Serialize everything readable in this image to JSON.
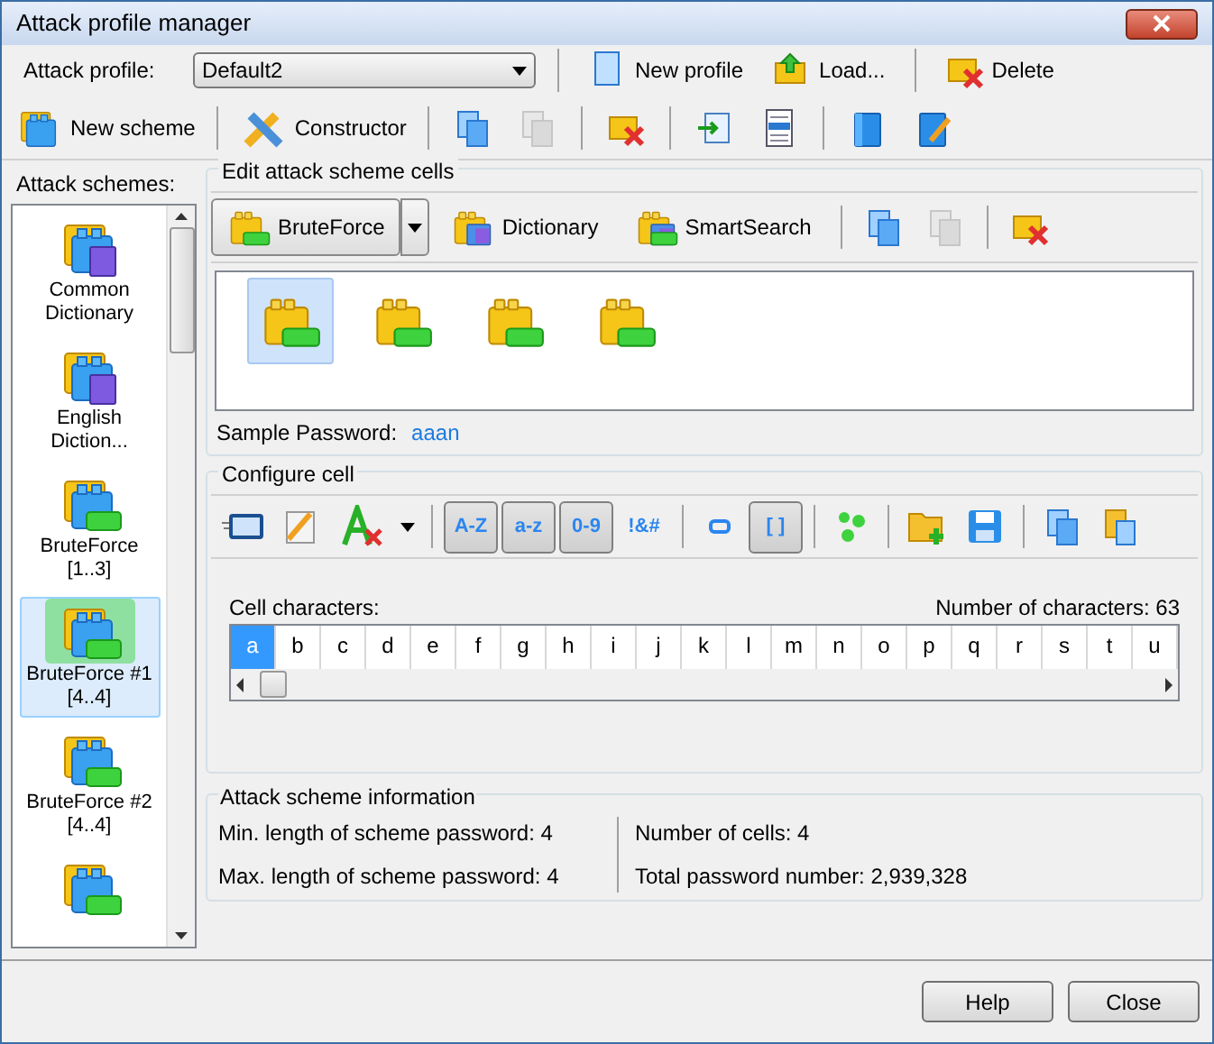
{
  "window": {
    "title": "Attack profile manager"
  },
  "profile_bar": {
    "label": "Attack profile:",
    "value": "Default2",
    "buttons": [
      {
        "label": "New profile",
        "kind": "new"
      },
      {
        "label": "Load...",
        "kind": "load"
      },
      {
        "label": "Delete",
        "kind": "delete"
      }
    ]
  },
  "toolbar": {
    "buttons": [
      {
        "label": "New scheme",
        "kind": "newscheme"
      },
      {
        "label": "Constructor",
        "kind": "constructor"
      }
    ],
    "icon_buttons": [
      {
        "kind": "copy",
        "disabled": false
      },
      {
        "kind": "paste",
        "disabled": true
      },
      {
        "kind": "delete",
        "disabled": false
      },
      {
        "kind": "import",
        "disabled": false
      },
      {
        "kind": "doc",
        "disabled": false
      },
      {
        "kind": "book",
        "disabled": false
      },
      {
        "kind": "edit",
        "disabled": false
      }
    ]
  },
  "schemes": {
    "title": "Attack schemes:",
    "items": [
      {
        "label": "Common\nDictionary",
        "kind": "dictionary",
        "selected": false
      },
      {
        "label": "English\nDiction...",
        "kind": "dictionary",
        "selected": false
      },
      {
        "label": "BruteForce\n[1..3]",
        "kind": "bruteforce",
        "selected": false
      },
      {
        "label": "BruteForce #1\n[4..4]",
        "kind": "bruteforce",
        "selected": true
      },
      {
        "label": "BruteForce #2\n[4..4]",
        "kind": "bruteforce",
        "selected": false
      },
      {
        "kind": "bruteforce",
        "selected": false
      }
    ]
  },
  "edit_cells": {
    "title": "Edit attack scheme cells",
    "cell_types": [
      {
        "label": "BruteForce",
        "selected": true
      },
      {
        "label": "Dictionary",
        "selected": false
      },
      {
        "label": "SmartSearch",
        "selected": false
      }
    ],
    "cells": [
      {
        "selected": true
      },
      {
        "selected": false
      },
      {
        "selected": false
      },
      {
        "selected": false
      }
    ],
    "sample_label": "Sample Password:",
    "sample_value": "aaan"
  },
  "configure": {
    "title": "Configure cell",
    "charset_toggles": [
      {
        "label": "A-Z",
        "selected": true
      },
      {
        "label": "a-z",
        "selected": true
      },
      {
        "label": "0-9",
        "selected": true
      },
      {
        "label": "!&#",
        "selected": false
      }
    ],
    "bracket_toggle": {
      "label": "[ ]",
      "selected": true
    },
    "chars_label": "Cell characters:",
    "count_label": "Number of characters: 63",
    "characters": [
      {
        "char": "a",
        "selected": true
      },
      {
        "char": "b",
        "selected": false
      },
      {
        "char": "c",
        "selected": false
      },
      {
        "char": "d",
        "selected": false
      },
      {
        "char": "e",
        "selected": false
      },
      {
        "char": "f",
        "selected": false
      },
      {
        "char": "g",
        "selected": false
      },
      {
        "char": "h",
        "selected": false
      },
      {
        "char": "i",
        "selected": false
      },
      {
        "char": "j",
        "selected": false
      },
      {
        "char": "k",
        "selected": false
      },
      {
        "char": "l",
        "selected": false
      },
      {
        "char": "m",
        "selected": false
      },
      {
        "char": "n",
        "selected": false
      },
      {
        "char": "o",
        "selected": false
      },
      {
        "char": "p",
        "selected": false
      },
      {
        "char": "q",
        "selected": false
      },
      {
        "char": "r",
        "selected": false
      },
      {
        "char": "s",
        "selected": false
      },
      {
        "char": "t",
        "selected": false
      },
      {
        "char": "u",
        "selected": false
      }
    ]
  },
  "info": {
    "title": "Attack scheme information",
    "left": [
      "Min. length of scheme password: 4",
      "Max. length of scheme password: 4"
    ],
    "right": [
      "Number of cells: 4",
      "Total password number: 2,939,328"
    ]
  },
  "footer_buttons": [
    "Help",
    "Close"
  ]
}
